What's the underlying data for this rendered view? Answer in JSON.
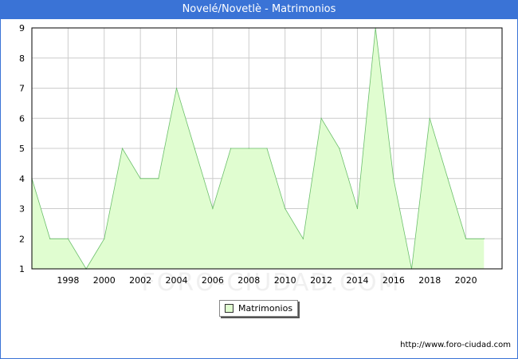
{
  "title": "Novelé/Novetlè - Matrimonios",
  "source": "http://www.foro-ciudad.com",
  "watermark": "FORO-CIUDAD.COM",
  "colors": {
    "title_bg": "#3a73d6",
    "area_fill": "#e0fdd0",
    "area_line": "#6cbf6c",
    "grid": "#cccccc"
  },
  "chart_data": {
    "type": "area",
    "title": "Novelé/Novetlè - Matrimonios",
    "x": [
      1996,
      1997,
      1998,
      1999,
      2000,
      2001,
      2002,
      2003,
      2004,
      2005,
      2006,
      2007,
      2008,
      2009,
      2010,
      2011,
      2012,
      2013,
      2014,
      2015,
      2016,
      2017,
      2018,
      2019,
      2020,
      2021
    ],
    "series": [
      {
        "name": "Matrimonios",
        "values": [
          4,
          2,
          2,
          1,
          2,
          5,
          4,
          4,
          7,
          5,
          3,
          5,
          5,
          5,
          3,
          2,
          6,
          5,
          3,
          9,
          4,
          1,
          6,
          4,
          2,
          2
        ]
      }
    ],
    "xticks": [
      "1998",
      "2000",
      "2002",
      "2004",
      "2006",
      "2008",
      "2010",
      "2012",
      "2014",
      "2016",
      "2018",
      "2020"
    ],
    "yticks": [
      "1",
      "2",
      "3",
      "4",
      "5",
      "6",
      "7",
      "8",
      "9"
    ],
    "xlim": [
      1996,
      2022
    ],
    "ylim": [
      1,
      9
    ],
    "grid": true,
    "legend_position": "bottom-center"
  }
}
